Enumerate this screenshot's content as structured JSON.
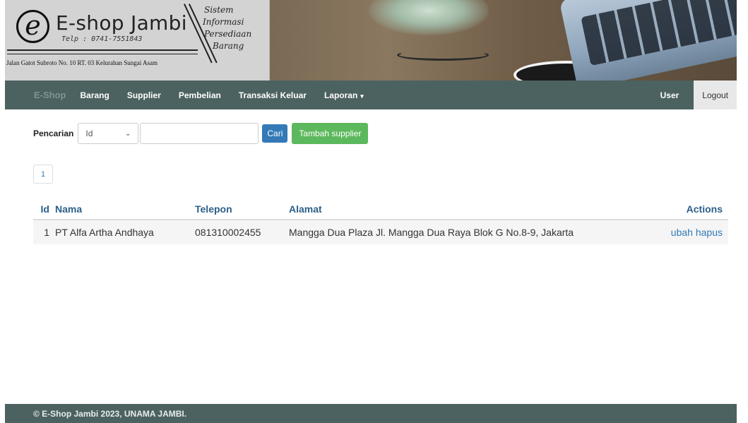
{
  "banner": {
    "logo_letter": "e",
    "shop_name": "E-shop Jambi",
    "phone": "Telp : 0741-7551843",
    "address": "Jalan Gatot Subroto No. 10 RT. 03 Kelurahan Sungai Asam",
    "tagline": [
      "Sistem",
      "Informasi",
      "Persediaan",
      "Barang"
    ]
  },
  "navbar": {
    "brand": "E-Shop",
    "items": [
      "Barang",
      "Supplier",
      "Pembelian",
      "Transaksi Keluar",
      "Laporan"
    ],
    "user": "User",
    "logout": "Logout"
  },
  "search": {
    "label": "Pencarian",
    "field_selected": "Id",
    "query_value": "",
    "search_button": "Cari",
    "add_button": "Tambah supplier"
  },
  "pagination": {
    "current_page": "1"
  },
  "table": {
    "headers": {
      "id": "Id",
      "nama": "Nama",
      "telepon": "Telepon",
      "alamat": "Alamat",
      "actions": "Actions"
    },
    "rows": [
      {
        "id": "1",
        "nama": "PT Alfa Artha Andhaya",
        "telepon": "081310002455",
        "alamat": "Mangga Dua Plaza Jl. Mangga Dua Raya Blok G No.8-9, Jakarta",
        "edit": "ubah",
        "delete": "hapus"
      }
    ]
  },
  "footer": {
    "text": "© E-Shop Jambi 2023, UNAMA JAMBI."
  },
  "colors": {
    "navbar_bg": "#4c6260",
    "primary": "#337ab7",
    "success": "#5cb85c"
  }
}
